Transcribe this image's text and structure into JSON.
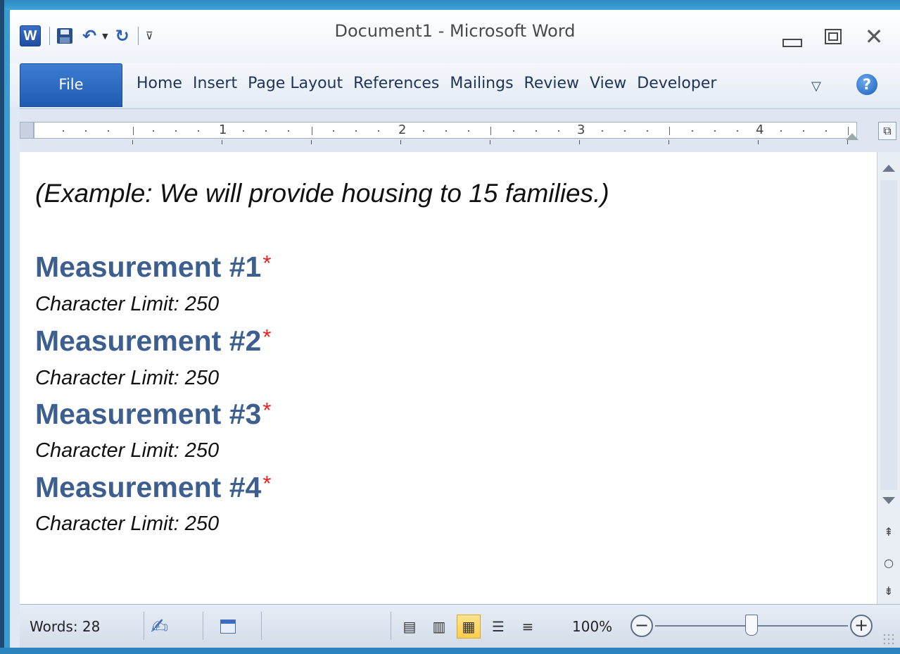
{
  "window": {
    "title": "Document1 - Microsoft Word"
  },
  "quick_access": {
    "app_icon": "W",
    "icons": [
      "word-icon",
      "save-icon",
      "undo-icon",
      "redo-icon",
      "customize-icon"
    ]
  },
  "ribbon": {
    "file_tab": "File",
    "tabs": [
      "Home",
      "Insert",
      "Page Layout",
      "References",
      "Mailings",
      "Review",
      "View",
      "Developer"
    ],
    "help": "?"
  },
  "ruler": {
    "numbers": [
      "1",
      "2",
      "3",
      "4"
    ]
  },
  "document": {
    "example": "(Example: We will provide housing to 15 families.)",
    "measurements": [
      {
        "heading": "Measurement #1",
        "required": "*",
        "limit": "Character Limit: 250"
      },
      {
        "heading": "Measurement #2",
        "required": "*",
        "limit": "Character Limit: 250"
      },
      {
        "heading": "Measurement #3",
        "required": "*",
        "limit": "Character Limit: 250"
      },
      {
        "heading": "Measurement #4",
        "required": "*",
        "limit": "Character Limit: 250"
      }
    ]
  },
  "statusbar": {
    "words": "Words: 28",
    "zoom": "100%",
    "zoom_fraction": 0.5,
    "active_view": "web-layout"
  },
  "colors": {
    "heading": "#3d5f8f",
    "required": "#e0241f",
    "file_tab": "#2a67c0",
    "desktop": "#3a9bd0"
  }
}
